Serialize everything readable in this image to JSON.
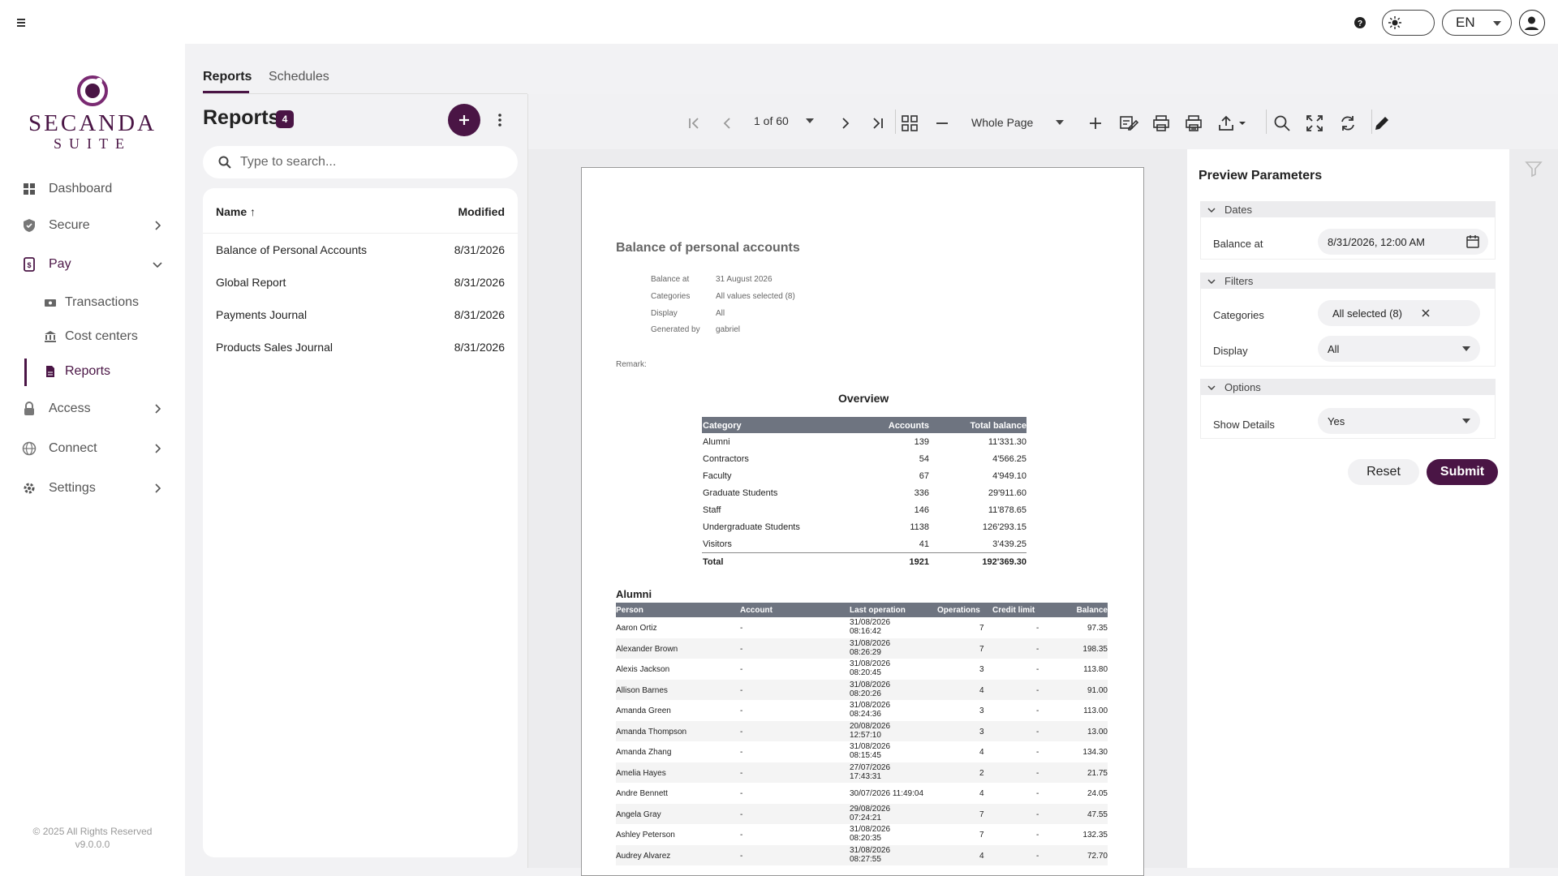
{
  "topbar": {
    "lang": "EN"
  },
  "logo": {
    "brand": "SECANDA",
    "sub": "SUITE"
  },
  "nav": {
    "dashboard": "Dashboard",
    "secure": "Secure",
    "pay": "Pay",
    "transactions": "Transactions",
    "cost_centers": "Cost centers",
    "reports": "Reports",
    "access": "Access",
    "connect": "Connect",
    "settings": "Settings"
  },
  "footer": {
    "copyright": "© 2025 All Rights Reserved",
    "version": "v9.0.0.0"
  },
  "tabs": {
    "reports": "Reports",
    "schedules": "Schedules"
  },
  "reports_panel": {
    "title": "Reports",
    "count": "4",
    "search_placeholder": "Type to search...",
    "col_name": "Name ↑",
    "col_modified": "Modified",
    "rows": [
      {
        "name": "Balance of Personal Accounts",
        "modified": "8/31/2026"
      },
      {
        "name": "Global Report",
        "modified": "8/31/2026"
      },
      {
        "name": "Payments Journal",
        "modified": "8/31/2026"
      },
      {
        "name": "Products Sales Journal",
        "modified": "8/31/2026"
      }
    ]
  },
  "viewer": {
    "page": "1 of 60",
    "zoom": "Whole Page"
  },
  "document": {
    "title": "Balance of personal accounts",
    "meta": [
      {
        "label": "Balance at",
        "value": "31 August 2026"
      },
      {
        "label": "Categories",
        "value": "All values selected (8)"
      },
      {
        "label": "Display",
        "value": "All"
      },
      {
        "label": "Generated by",
        "value": "gabriel"
      }
    ],
    "remark": "Remark:",
    "overview_title": "Overview",
    "overview_headers": [
      "Category",
      "Accounts",
      "Total balance"
    ],
    "overview_rows": [
      [
        "Alumni",
        "139",
        "11'331.30"
      ],
      [
        "Contractors",
        "54",
        "4'566.25"
      ],
      [
        "Faculty",
        "67",
        "4'949.10"
      ],
      [
        "Graduate Students",
        "336",
        "29'911.60"
      ],
      [
        "Staff",
        "146",
        "11'878.65"
      ],
      [
        "Undergraduate Students",
        "1138",
        "126'293.15"
      ],
      [
        "Visitors",
        "41",
        "3'439.25"
      ]
    ],
    "overview_total": [
      "Total",
      "1921",
      "192'369.30"
    ],
    "alumni_title": "Alumni",
    "alumni_headers": [
      "Person",
      "Account",
      "Last operation",
      "Operations",
      "Credit limit",
      "Balance"
    ],
    "alumni_rows": [
      [
        "Aaron Ortiz",
        "-",
        "31/08/2026 08:16:42",
        "7",
        "-",
        "97.35"
      ],
      [
        "Alexander Brown",
        "-",
        "31/08/2026 08:26:29",
        "7",
        "-",
        "198.35"
      ],
      [
        "Alexis Jackson",
        "-",
        "31/08/2026 08:20:45",
        "3",
        "-",
        "113.80"
      ],
      [
        "Allison Barnes",
        "-",
        "31/08/2026 08:20:26",
        "4",
        "-",
        "91.00"
      ],
      [
        "Amanda Green",
        "-",
        "31/08/2026 08:24:36",
        "3",
        "-",
        "113.00"
      ],
      [
        "Amanda Thompson",
        "-",
        "20/08/2026 12:57:10",
        "3",
        "-",
        "13.00"
      ],
      [
        "Amanda Zhang",
        "-",
        "31/08/2026 08:15:45",
        "4",
        "-",
        "134.30"
      ],
      [
        "Amelia Hayes",
        "-",
        "27/07/2026 17:43:31",
        "2",
        "-",
        "21.75"
      ],
      [
        "Andre Bennett",
        "-",
        "30/07/2026 11:49:04",
        "4",
        "-",
        "24.05"
      ],
      [
        "Angela Gray",
        "-",
        "29/08/2026 07:24:21",
        "7",
        "-",
        "47.55"
      ],
      [
        "Ashley Peterson",
        "-",
        "31/08/2026 08:20:35",
        "7",
        "-",
        "132.35"
      ],
      [
        "Audrey Alvarez",
        "-",
        "31/08/2026 08:27:55",
        "4",
        "-",
        "72.70"
      ]
    ]
  },
  "params": {
    "title": "Preview Parameters",
    "dates_section": "Dates",
    "balance_label": "Balance at",
    "balance_value": "8/31/2026, 12:00 AM",
    "filters_section": "Filters",
    "categories_label": "Categories",
    "categories_value": "All selected (8)",
    "display_label": "Display",
    "display_value": "All",
    "options_section": "Options",
    "details_label": "Show Details",
    "details_value": "Yes",
    "reset": "Reset",
    "submit": "Submit"
  }
}
